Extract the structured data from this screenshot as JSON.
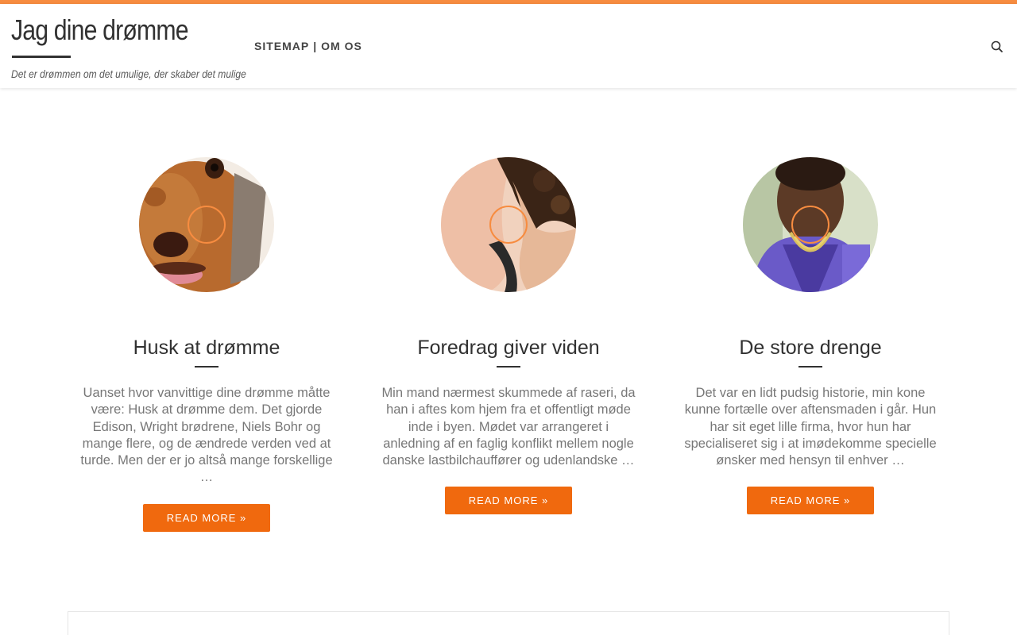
{
  "site": {
    "title": "Jag dine drømme",
    "tagline": "Det er drømmen om det umulige, der skaber det mulige"
  },
  "nav": {
    "items": [
      {
        "label": "SITEMAP"
      },
      {
        "label": "OM OS"
      }
    ],
    "separator": "|"
  },
  "icons": {
    "search": "search-icon"
  },
  "colors": {
    "accent": "#f78c40",
    "button": "#f0690e"
  },
  "posts": [
    {
      "title": "Husk at drømme",
      "excerpt": "Uanset hvor vanvittige dine drømme måtte være: Husk at drømme dem. Det gjorde Edison, Wright brødrene, Niels Bohr og mange flere, og de ændrede verden ved at turde. Men der er jo altså mange forskellige …",
      "button": "READ MORE »"
    },
    {
      "title": "Foredrag giver viden",
      "excerpt": "Min mand nærmest skummede af raseri, da han i aftes kom hjem fra et offentligt møde inde i byen. Mødet var arrangeret i anledning af en faglig konflikt mellem nogle danske lastbilchauffører og udenlandske …",
      "button": "READ MORE »"
    },
    {
      "title": "De store drenge",
      "excerpt": "Det var en lidt pudsig historie, min kone kunne fortælle over aftensmaden i går. Hun har sit eget lille firma, hvor hun har specialiseret sig i at imødekomme specielle ønsker med hensyn til enhver …",
      "button": "READ MORE »"
    }
  ]
}
